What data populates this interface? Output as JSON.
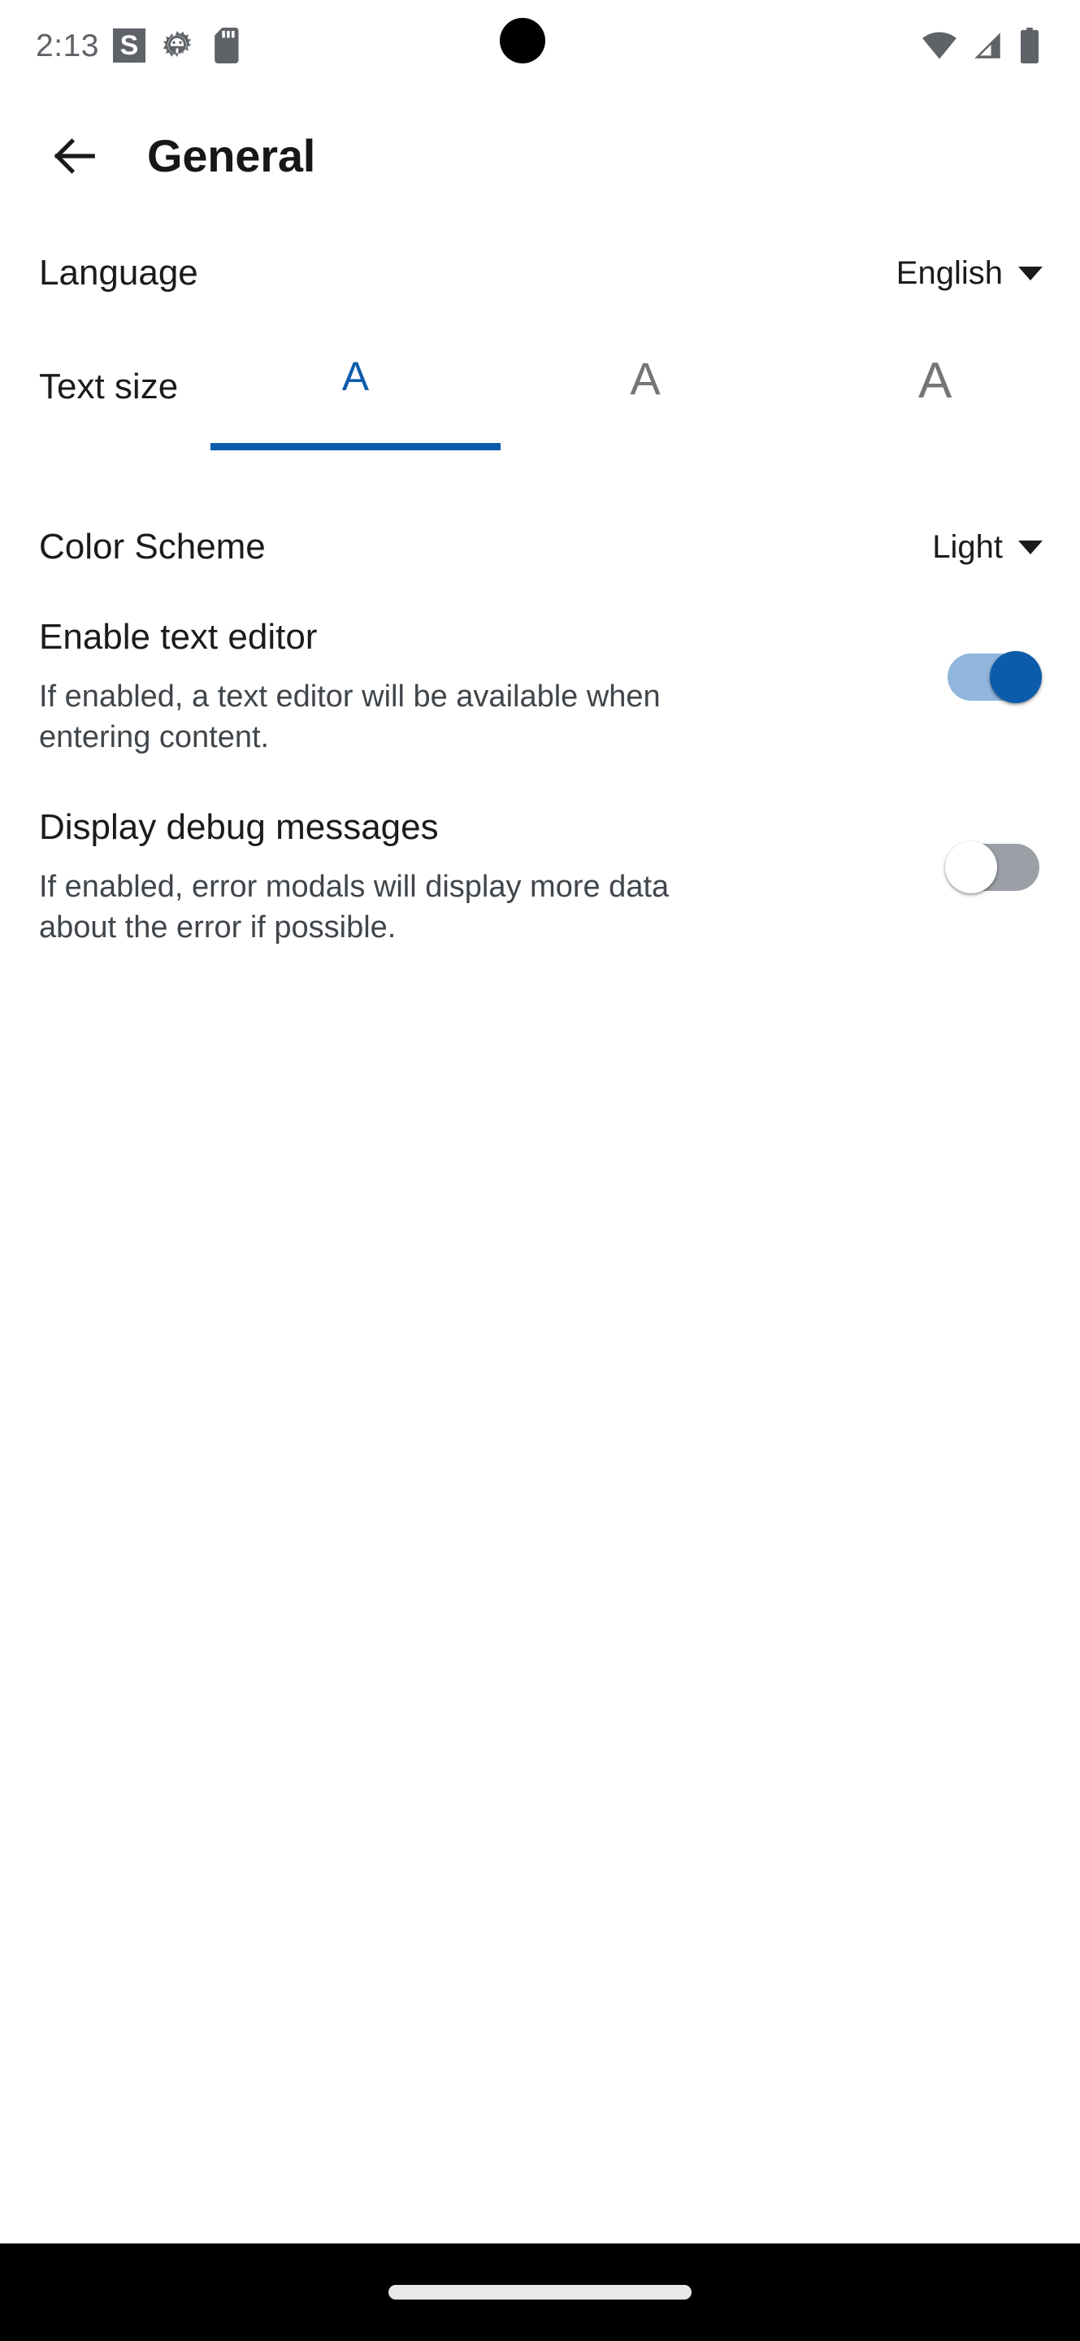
{
  "status_bar": {
    "time": "2:13",
    "left_icons": [
      {
        "name": "s-badge-icon",
        "label": "S"
      },
      {
        "name": "bug-icon",
        "label": ""
      },
      {
        "name": "sd-card-icon",
        "label": ""
      }
    ],
    "notification_dot": {
      "name": "notification-dot-icon"
    },
    "right_icons": [
      {
        "name": "wifi-icon",
        "label": ""
      },
      {
        "name": "cellular-signal-icon",
        "label": ""
      },
      {
        "name": "battery-icon",
        "label": ""
      }
    ],
    "icon_color": "#5f6368"
  },
  "app_bar": {
    "back_icon": "arrow-back-icon",
    "title": "General"
  },
  "settings": {
    "language": {
      "label": "Language",
      "value": "English",
      "caret_icon": "chevron-down-icon"
    },
    "text_size": {
      "label": "Text size",
      "options": [
        {
          "letter": "A",
          "selected": true
        },
        {
          "letter": "A",
          "selected": false
        },
        {
          "letter": "A",
          "selected": false
        }
      ],
      "selected_index": 0,
      "accent_color": "#0d5cab",
      "inactive_color": "#757575"
    },
    "color_scheme": {
      "label": "Color Scheme",
      "value": "Light",
      "caret_icon": "chevron-down-icon"
    },
    "enable_text_editor": {
      "title": "Enable text editor",
      "description": "If enabled, a text editor will be available when entering content.",
      "enabled": true,
      "on_track_color": "#90b6dd",
      "on_thumb_color": "#0d5cab"
    },
    "display_debug_messages": {
      "title": "Display debug messages",
      "description": "If enabled, error modals will display more data about the error if possible.",
      "enabled": false,
      "off_track_color": "#9aa0a6",
      "off_thumb_color": "#ffffff"
    }
  },
  "nav_bar": {
    "gesture_pill": "home-gesture-pill",
    "background_color": "#000000"
  }
}
